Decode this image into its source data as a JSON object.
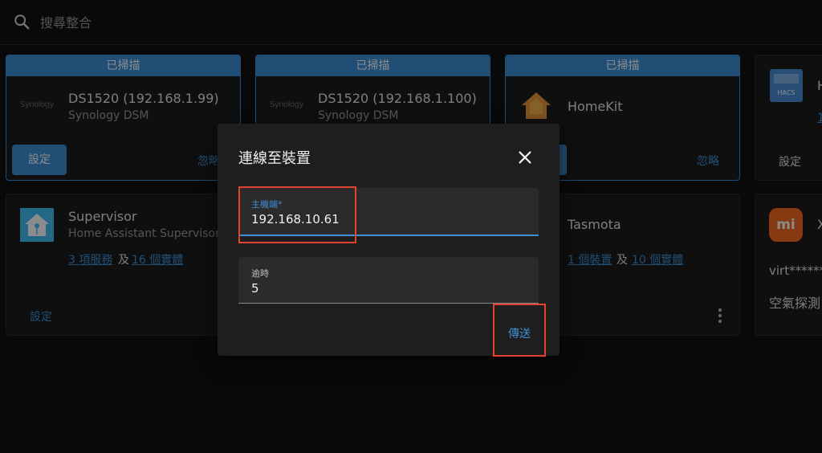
{
  "search": {
    "placeholder": "搜尋整合"
  },
  "cards": {
    "ds1": {
      "header": "已掃描",
      "logo": "Synology",
      "title": "DS1520 (192.168.1.99)",
      "subtitle": "Synology DSM",
      "setup": "設定",
      "ignore": "忽略"
    },
    "ds2": {
      "header": "已掃描",
      "logo": "Synology",
      "title": "DS1520 (192.168.1.100)",
      "subtitle": "Synology DSM"
    },
    "homekit": {
      "header": "已掃描",
      "title": "HomeKit",
      "ignore": "忽略"
    },
    "hacs": {
      "logo": "HACS",
      "title_partial": "H",
      "link_partial": "1",
      "setup": "設定"
    },
    "supervisor": {
      "title": "Supervisor",
      "subtitle": "Home Assistant Supervisor",
      "services": "3 項服務",
      "and": "及",
      "entities": "16 個實體",
      "setup": "設定"
    },
    "tasmota": {
      "title": "Tasmota",
      "devices": "1 個裝置",
      "and": "及",
      "entities": "10 個實體"
    },
    "xiaomi": {
      "logo": "mi",
      "title_partial": "X",
      "device": "virt******",
      "desc": "空氣探測"
    }
  },
  "dialog": {
    "title": "連線至裝置",
    "host_label": "主機端*",
    "host_value": "192.168.10.61",
    "timeout_label": "逾時",
    "timeout_value": "5",
    "submit": "傳送"
  },
  "colors": {
    "accent": "#3d8fd6",
    "highlight": "#e0432f",
    "background": "#111111",
    "card": "#1c1c1c"
  }
}
